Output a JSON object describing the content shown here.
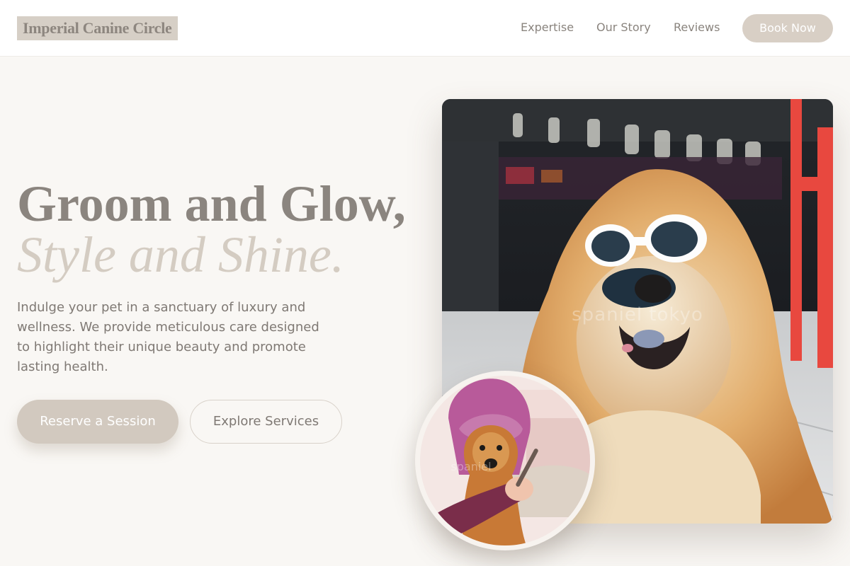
{
  "header": {
    "logo_text": "Imperial Canine Circle",
    "nav": [
      "Expertise",
      "Our Story",
      "Reviews"
    ],
    "cta_label": "Book Now"
  },
  "hero": {
    "headline": "Groom and Glow,",
    "headline_accent": "Style and Shine.",
    "intro": "Indulge your pet in a sanctuary of luxury and wellness. We provide meticulous care designed to highlight their unique beauty and promote lasting health.",
    "primary_cta": "Reserve a Session",
    "secondary_cta": "Explore Services"
  },
  "images": {
    "main_watermark": "spaniel tokyo",
    "inset_watermark": "spaniel"
  },
  "colors": {
    "background": "#f9f7f4",
    "accent": "#d2c9bf",
    "text": "#7f7974",
    "logo_bg": "#d6cfc6"
  }
}
